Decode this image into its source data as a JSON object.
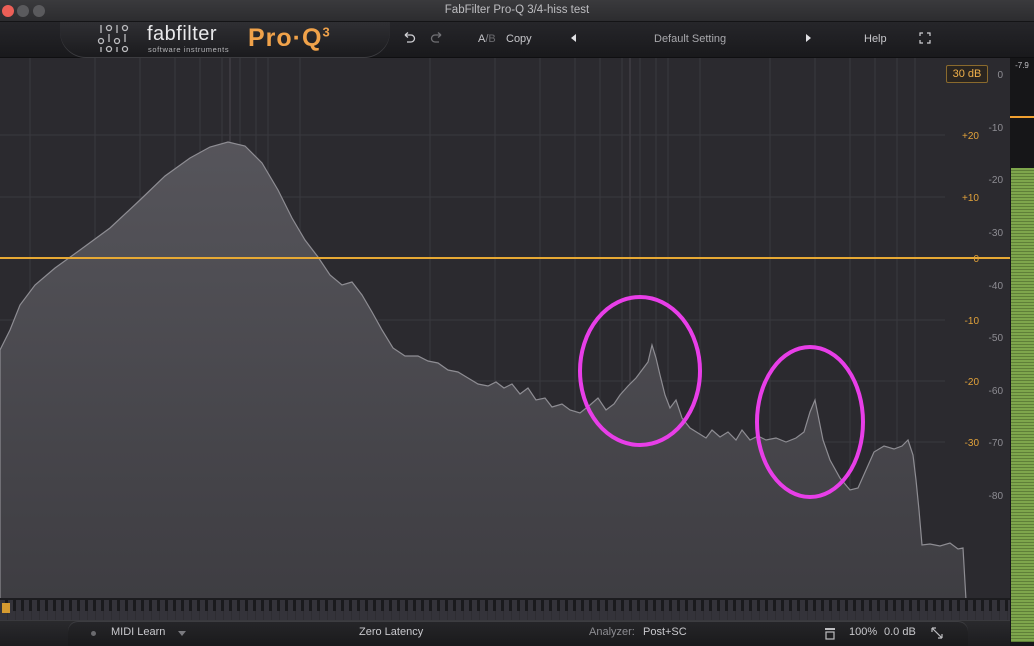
{
  "window": {
    "title": "FabFilter Pro-Q 3/4-hiss test"
  },
  "logo": {
    "brand": "fabfilter",
    "subtitle": "software instruments",
    "product": "Pro·Q",
    "version": "3"
  },
  "header": {
    "ab_a": "A",
    "ab_slash": "/",
    "ab_b": "B",
    "copy": "Copy",
    "preset": "Default Setting",
    "help": "Help",
    "icons": [
      "undo-icon",
      "redo-icon",
      "prev-preset-icon",
      "next-preset-icon",
      "fullscreen-icon"
    ]
  },
  "display": {
    "range_badge": "30 dB",
    "eq_scale": [
      "+20",
      "+10",
      "0",
      "-10",
      "-20",
      "-30"
    ],
    "analyzer_scale": [
      "0",
      "-10",
      "-20",
      "-30",
      "-40",
      "-50",
      "-60",
      "-70",
      "-80"
    ],
    "meter_peak": "-7.9",
    "annotation_color": "#e83ee8",
    "accent": "#f0a030"
  },
  "bottom": {
    "midi_learn": "MIDI Learn",
    "latency": "Zero Latency",
    "analyzer_label": "Analyzer:",
    "analyzer_value": "Post+SC",
    "zoom": "100%",
    "gain": "0.0 dB"
  }
}
